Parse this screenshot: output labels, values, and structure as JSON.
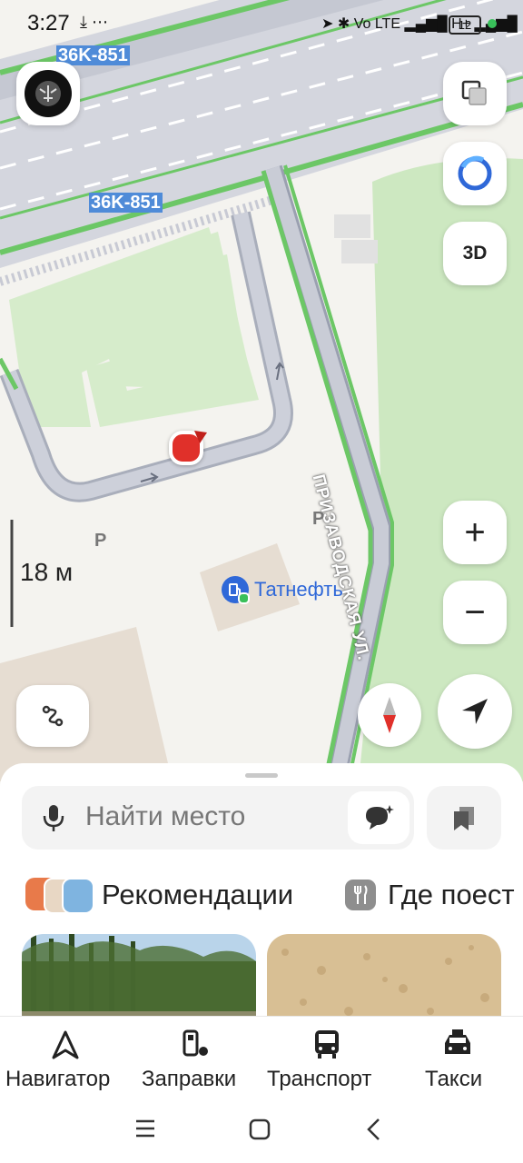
{
  "status_bar": {
    "time": "3:27",
    "icons": "⤓ ⋯",
    "right_icons": "➤ ✱ Vo LTE ▂▄▆█ H+ ▂▄▆█",
    "battery": "12"
  },
  "map": {
    "road_label_1": "36K-851",
    "road_label_2": "36K-851",
    "street_label": "ПРИЗАВОДСКАЯ УЛ.",
    "poi_label": "Татнефть",
    "parking_1": "P",
    "parking_2": "P",
    "scale_label": "18 м",
    "btn_3d": "3D",
    "zoom_in": "+",
    "zoom_out": "−"
  },
  "search": {
    "placeholder": "Найти место"
  },
  "chips": [
    {
      "label": "Рекомендации"
    },
    {
      "label": "Где поест"
    }
  ],
  "tabs": [
    {
      "label": "Навигатор",
      "icon": "navigator-icon"
    },
    {
      "label": "Заправки",
      "icon": "fuel-icon"
    },
    {
      "label": "Транспорт",
      "icon": "bus-icon"
    },
    {
      "label": "Такси",
      "icon": "taxi-icon"
    }
  ],
  "colors": {
    "road_green": "#6cc766",
    "accent": "#2f68d8",
    "location": "#e0302a",
    "park": "#cde8c1"
  }
}
